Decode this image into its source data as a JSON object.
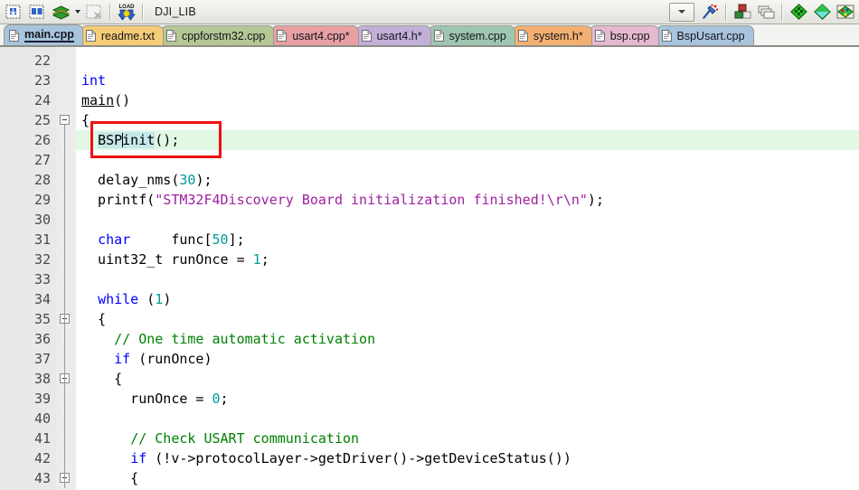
{
  "toolbar": {
    "buttons": [
      {
        "name": "insert-item-icon",
        "title": "Insert"
      },
      {
        "name": "insert-items-icon",
        "title": "Insert multiple"
      },
      {
        "name": "layers-icon",
        "title": "Layers"
      },
      {
        "name": "delete-item-icon",
        "title": "Delete"
      },
      {
        "name": "load-icon",
        "title": "Load"
      }
    ],
    "project_label": "DJI_LIB",
    "right_buttons": [
      {
        "name": "configure-icon",
        "title": "Configure"
      },
      {
        "name": "blocks-icon",
        "title": "Components"
      },
      {
        "name": "windows-icon",
        "title": "Windows"
      },
      {
        "name": "green-diamond-icon",
        "title": "Build"
      },
      {
        "name": "teal-diamond-icon",
        "title": "Rebuild"
      },
      {
        "name": "palette-diamond-icon",
        "title": "Options"
      }
    ],
    "combo_value": ""
  },
  "tabs": [
    {
      "label": "main.cpp",
      "color": "#a8c4dd",
      "active": true,
      "modified": false
    },
    {
      "label": "readme.txt",
      "color": "#f6cd77",
      "active": false,
      "modified": false
    },
    {
      "label": "cppforstm32.cpp",
      "color": "#b5c795",
      "active": false,
      "modified": false
    },
    {
      "label": "usart4.cpp*",
      "color": "#e8a0a4",
      "active": false,
      "modified": true
    },
    {
      "label": "usart4.h*",
      "color": "#c3b0d8",
      "active": false,
      "modified": true
    },
    {
      "label": "system.cpp",
      "color": "#9ec6b1",
      "active": false,
      "modified": false
    },
    {
      "label": "system.h*",
      "color": "#f4b073",
      "active": false,
      "modified": true
    },
    {
      "label": "bsp.cpp",
      "color": "#e6b9cf",
      "active": false,
      "modified": false
    },
    {
      "label": "BspUsart.cpp",
      "color": "#a8c4dd",
      "active": false,
      "modified": false
    }
  ],
  "editor": {
    "first_line_number": 22,
    "highlighted_line_number": 26,
    "cursor_line": 26,
    "cursor_column": 6,
    "selection_text": "BSPinit",
    "highlight_color": "#e0f8e4",
    "selection_color": "#c5e8e8",
    "annotation_color": "#ee1111",
    "fold_lines": [
      25,
      35,
      38,
      43
    ],
    "lines": [
      {
        "n": 22,
        "text": ""
      },
      {
        "n": 23,
        "text": "int"
      },
      {
        "n": 24,
        "text": "main()"
      },
      {
        "n": 25,
        "text": "{"
      },
      {
        "n": 26,
        "text": "  BSPinit();"
      },
      {
        "n": 27,
        "text": ""
      },
      {
        "n": 28,
        "text": "  delay_nms(30);"
      },
      {
        "n": 29,
        "text": "  printf(\"STM32F4Discovery Board initialization finished!\\r\\n\");"
      },
      {
        "n": 30,
        "text": ""
      },
      {
        "n": 31,
        "text": "  char     func[50];"
      },
      {
        "n": 32,
        "text": "  uint32_t runOnce = 1;"
      },
      {
        "n": 33,
        "text": ""
      },
      {
        "n": 34,
        "text": "  while (1)"
      },
      {
        "n": 35,
        "text": "  {"
      },
      {
        "n": 36,
        "text": "    // One time automatic activation"
      },
      {
        "n": 37,
        "text": "    if (runOnce)"
      },
      {
        "n": 38,
        "text": "    {"
      },
      {
        "n": 39,
        "text": "      runOnce = 0;"
      },
      {
        "n": 40,
        "text": ""
      },
      {
        "n": 41,
        "text": "      // Check USART communication"
      },
      {
        "n": 42,
        "text": "      if (!v->protocolLayer->getDriver()->getDeviceStatus())"
      },
      {
        "n": 43,
        "text": "      {"
      }
    ]
  }
}
